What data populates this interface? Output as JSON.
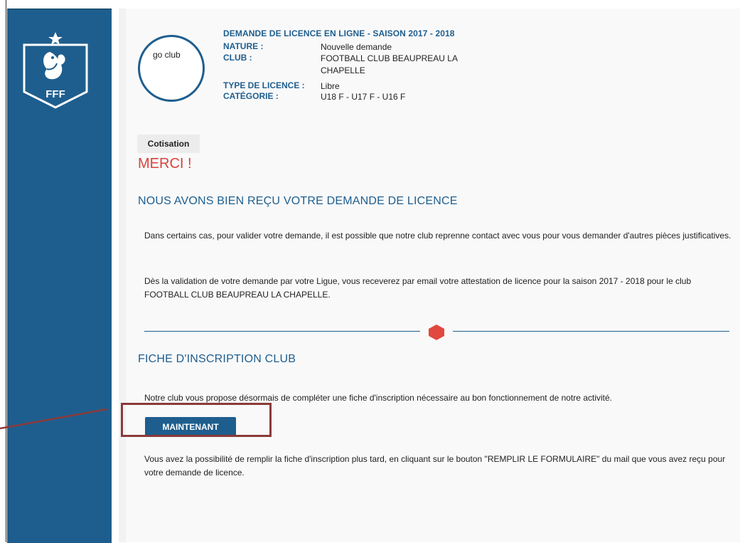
{
  "logo": {
    "text": "FFF",
    "icon": "rooster-icon"
  },
  "profile": {
    "avatar_label": "go club"
  },
  "request": {
    "title": "DEMANDE DE LICENCE EN LIGNE - SAISON 2017 - 2018",
    "nature_label": "NATURE :",
    "nature_value": "Nouvelle demande",
    "club_label": "CLUB :",
    "club_value_line1": "FOOTBALL CLUB BEAUPREAU LA",
    "club_value_line2": "CHAPELLE",
    "type_label": "TYPE DE LICENCE :",
    "type_value": "Libre",
    "category_label": "CATÉGORIE :",
    "category_value": "U18 F - U17 F - U16 F"
  },
  "tabs": {
    "cotisation": "Cotisation"
  },
  "confirmation": {
    "merci": "MERCI !",
    "heading": "NOUS AVONS BIEN REÇU VOTRE DEMANDE DE LICENCE",
    "para1": "Dans certains cas, pour valider votre demande, il est possible que notre club reprenne contact avec vous pour vous demander d'autres pièces justificatives.",
    "para2": "Dès la validation de votre demande par votre Ligue, vous receverez par email votre attestation de licence pour la saison 2017 - 2018 pour le club FOOTBALL CLUB BEAUPREAU LA CHAPELLE."
  },
  "inscription": {
    "heading": "FICHE D'INSCRIPTION CLUB",
    "intro": "Notre club vous propose désormais de compléter une fiche d'inscription nécessaire au bon fonctionnement de notre activité.",
    "button_label": "MAINTENANT",
    "later": "Vous avez la possibilité de remplir la fiche d'inscription plus tard, en cliquant sur le bouton \"REMPLIR LE FORMULAIRE\" du mail que vous avez reçu pour votre demande de licence."
  },
  "colors": {
    "brand": "#1e5e8e",
    "accent_red": "#d8433c",
    "highlight": "#8b3a3a"
  }
}
